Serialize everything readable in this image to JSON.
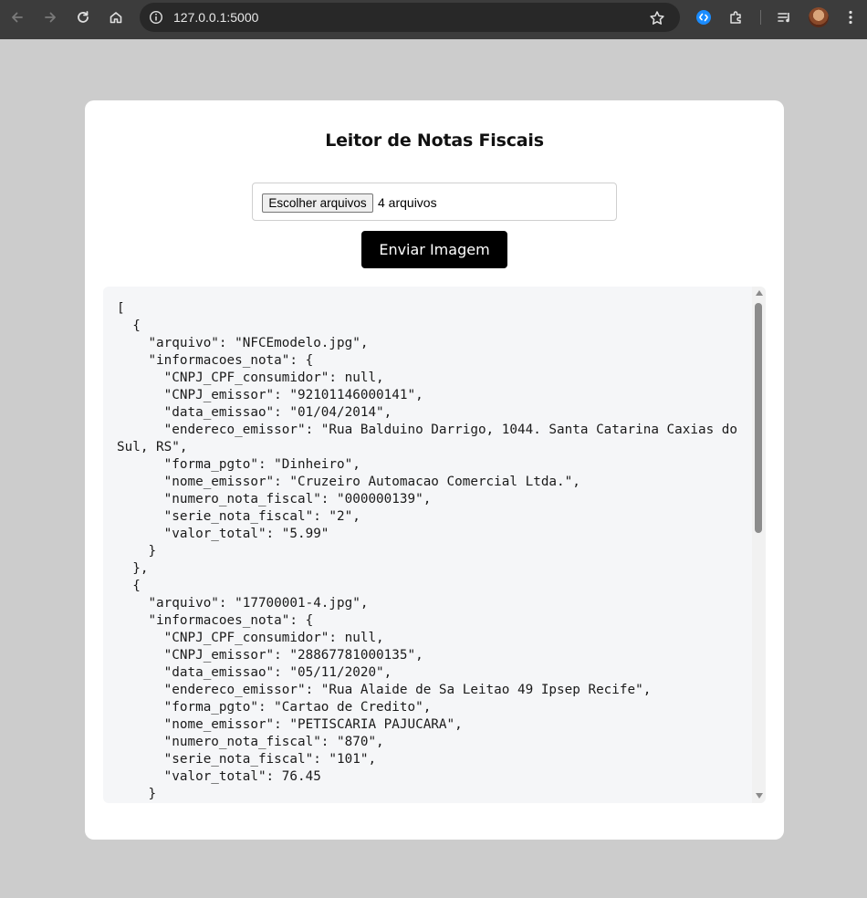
{
  "browser": {
    "url": "127.0.0.1:5000",
    "icons": [
      "back-icon",
      "forward-icon",
      "reload-icon",
      "home-icon",
      "site-info-icon",
      "bookmark-star-icon",
      "shazam-extension-icon",
      "extensions-puzzle-icon",
      "media-control-icon",
      "profile-avatar",
      "menu-kebab-icon"
    ]
  },
  "page": {
    "title": "Leitor de Notas Fiscais",
    "file_button_label": "Escolher arquivos",
    "file_count": "4 arquivos",
    "submit_label": "Enviar Imagem",
    "output": "[\n  {\n    \"arquivo\": \"NFCEmodelo.jpg\",\n    \"informacoes_nota\": {\n      \"CNPJ_CPF_consumidor\": null,\n      \"CNPJ_emissor\": \"92101146000141\",\n      \"data_emissao\": \"01/04/2014\",\n      \"endereco_emissor\": \"Rua Balduino Darrigo, 1044. Santa Catarina Caxias do Sul, RS\",\n      \"forma_pgto\": \"Dinheiro\",\n      \"nome_emissor\": \"Cruzeiro Automacao Comercial Ltda.\",\n      \"numero_nota_fiscal\": \"000000139\",\n      \"serie_nota_fiscal\": \"2\",\n      \"valor_total\": \"5.99\"\n    }\n  },\n  {\n    \"arquivo\": \"17700001-4.jpg\",\n    \"informacoes_nota\": {\n      \"CNPJ_CPF_consumidor\": null,\n      \"CNPJ_emissor\": \"28867781000135\",\n      \"data_emissao\": \"05/11/2020\",\n      \"endereco_emissor\": \"Rua Alaide de Sa Leitao 49 Ipsep Recife\",\n      \"forma_pgto\": \"Cartao de Credito\",\n      \"nome_emissor\": \"PETISCARIA PAJUCARA\",\n      \"numero_nota_fiscal\": \"870\",\n      \"serie_nota_fiscal\": \"101\",\n      \"valor_total\": 76.45\n    }"
  },
  "colors": {
    "chrome_bg": "#3c3c3c",
    "omnibox_bg": "#282828",
    "page_bg": "#cccccc",
    "card_bg": "#ffffff",
    "button_bg": "#000000",
    "output_bg": "#f5f6f8"
  }
}
